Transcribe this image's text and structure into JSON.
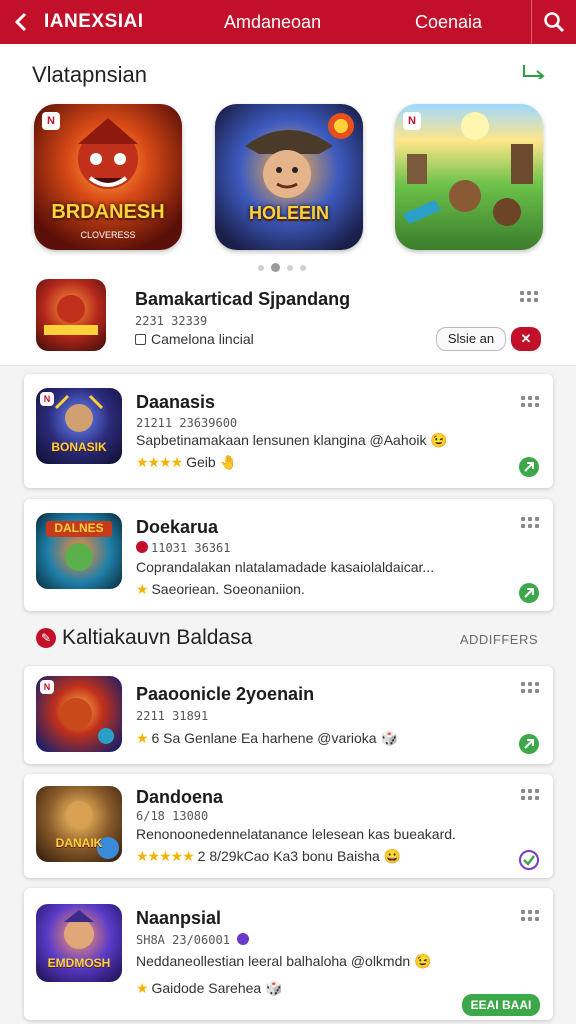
{
  "topbar": {
    "title": "IANEXSIAI",
    "center": "Amdaneoan",
    "right": "Coenaia"
  },
  "featured": {
    "title": "Vlatapnsian",
    "tiles": [
      {
        "caption": "BRDANESH",
        "sub": "CLOVERESS"
      },
      {
        "caption": "HOLEEIN",
        "sub": ""
      },
      {
        "caption": "",
        "sub": ""
      }
    ]
  },
  "plain_item": {
    "title": "Bamakarticad Sjpandang",
    "meta": "2231 32339",
    "sub": "Camelona lincial",
    "button": "Slsie an"
  },
  "cards": [
    {
      "title": "Daanasis",
      "meta": "21211 23639600",
      "desc": "Sapbetinamakaan lensunen klangina @Aahoik",
      "stars": "★★★★",
      "rating_text": "Geib",
      "icon_caption": "BONASIK"
    },
    {
      "title": "Doekarua",
      "meta": "11031 36361",
      "desc": "Coprandalakan nlatalamadade kasaiolaldaicar...",
      "stars": "★",
      "rating_text": "Saeoriean. Soeonaniion.",
      "icon_caption": "DALNES"
    }
  ],
  "category": {
    "title": "Kaltiakauvn Baldasa",
    "link": "ADDIFFERS"
  },
  "cards2": [
    {
      "title": "Paaoonicle 2yoenain",
      "meta": "2211 31891",
      "desc": "",
      "stars": "★",
      "rating_text": "6 Sa Genlane Ea harhene @varioka",
      "icon_caption": ""
    },
    {
      "title": "Dandoena",
      "meta": "6/18 13080",
      "desc": "Renonoonedennelatanance lelesean kas bueakard.",
      "stars": "★★★★★",
      "rating_text": "2 8/29kCao Ka3 bonu Baisha",
      "icon_caption": "DANAIK"
    },
    {
      "title": "Naanpsial",
      "meta": "SH8A 23/06001",
      "desc": "Neddaneollestian leeral balhaloha @olkmdn",
      "stars": "★",
      "rating_text": "Gaidode Sarehea",
      "button": "EEAI BAAI",
      "icon_caption": "EMDMOSH"
    }
  ],
  "colors": {
    "accent": "#c2102a",
    "green": "#3da84a",
    "star": "#f5b301"
  }
}
